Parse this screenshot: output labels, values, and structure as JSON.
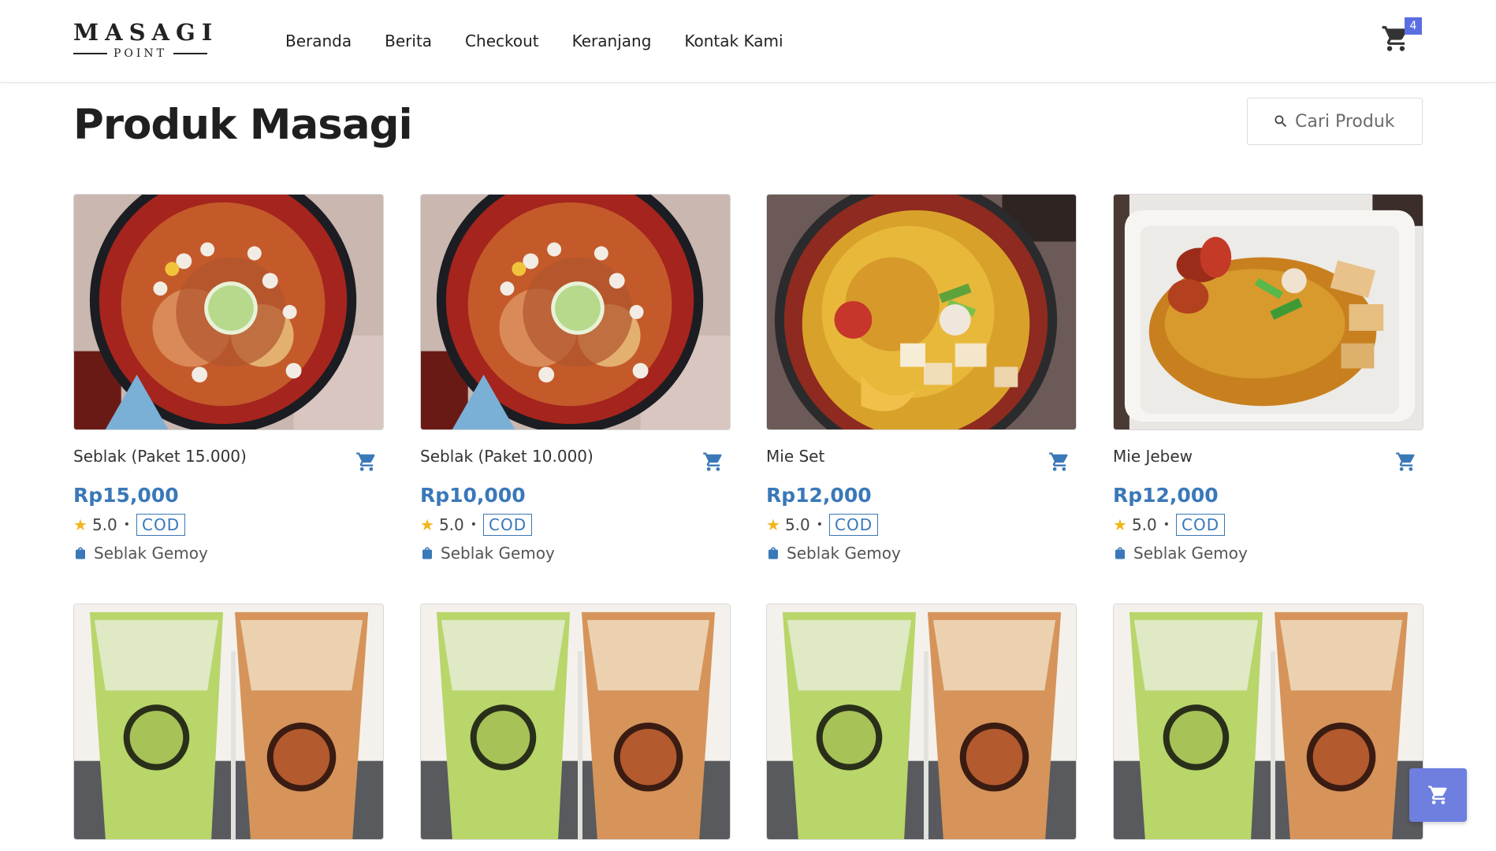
{
  "brand": {
    "name": "MASAGI",
    "sub": "POINT"
  },
  "nav": [
    "Beranda",
    "Berita",
    "Checkout",
    "Keranjang",
    "Kontak Kami"
  ],
  "cart": {
    "count": "4",
    "icon": "shopping-cart-icon"
  },
  "page": {
    "title": "Produk Masagi"
  },
  "search": {
    "placeholder": "Cari Produk",
    "value": ""
  },
  "colors": {
    "accent": "#3a78b8",
    "badge": "#5b6ee1",
    "fab": "#6e7fe0",
    "star": "#f2b51a"
  },
  "products": [
    {
      "name": "Seblak (Paket 15.000)",
      "price": "Rp15,000",
      "rating": "5.0",
      "tag": "COD",
      "shop": "Seblak Gemoy",
      "image": "seblak-bowl"
    },
    {
      "name": "Seblak (Paket 10.000)",
      "price": "Rp10,000",
      "rating": "5.0",
      "tag": "COD",
      "shop": "Seblak Gemoy",
      "image": "seblak-bowl"
    },
    {
      "name": "Mie Set",
      "price": "Rp12,000",
      "rating": "5.0",
      "tag": "COD",
      "shop": "Seblak Gemoy",
      "image": "noodle-bowl"
    },
    {
      "name": "Mie Jebew",
      "price": "Rp12,000",
      "rating": "5.0",
      "tag": "COD",
      "shop": "Seblak Gemoy",
      "image": "noodle-box"
    },
    {
      "image": "gemoy-drinks"
    },
    {
      "image": "gemoy-drinks"
    },
    {
      "image": "gemoy-drinks"
    },
    {
      "image": "gemoy-drinks"
    }
  ]
}
